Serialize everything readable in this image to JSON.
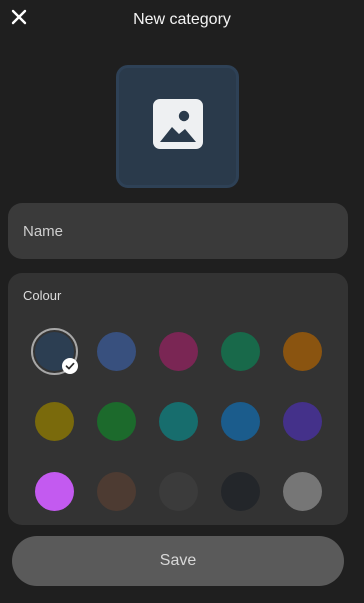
{
  "header": {
    "title": "New category",
    "close_icon": "close-icon"
  },
  "icon_preview": {
    "icon": "image-icon"
  },
  "name_field": {
    "placeholder": "Name",
    "value": ""
  },
  "colour_section": {
    "label": "Colour",
    "swatches": [
      {
        "color": "#2c3e52",
        "selected": true
      },
      {
        "color": "#38507e",
        "selected": false
      },
      {
        "color": "#7a2654",
        "selected": false
      },
      {
        "color": "#18694a",
        "selected": false
      },
      {
        "color": "#8a5410",
        "selected": false
      },
      {
        "color": "#7a6a0c",
        "selected": false
      },
      {
        "color": "#1c6a2c",
        "selected": false
      },
      {
        "color": "#176d6d",
        "selected": false
      },
      {
        "color": "#1b5c8c",
        "selected": false
      },
      {
        "color": "#44318a",
        "selected": false
      },
      {
        "color": "#c35af0",
        "selected": false
      },
      {
        "color": "#4d3b32",
        "selected": false
      },
      {
        "color": "#3b3b3b",
        "selected": false
      },
      {
        "color": "#23262a",
        "selected": false
      },
      {
        "color": "#767676",
        "selected": false
      }
    ]
  },
  "save_button": {
    "label": "Save"
  }
}
